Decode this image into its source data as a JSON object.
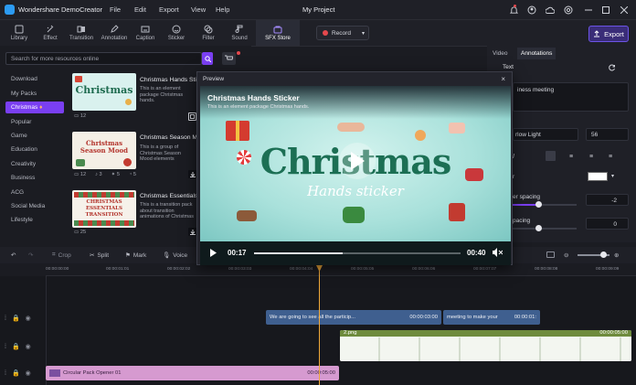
{
  "app": {
    "title": "Wondershare DemoCreator",
    "project": "My Project",
    "menu": [
      "File",
      "Edit",
      "Export",
      "View",
      "Help"
    ]
  },
  "toolbar": {
    "tools": [
      {
        "label": "Library",
        "icon": "library-icon"
      },
      {
        "label": "Effect",
        "icon": "effect-icon"
      },
      {
        "label": "Transition",
        "icon": "transition-icon"
      },
      {
        "label": "Annotation",
        "icon": "annotation-icon"
      },
      {
        "label": "Caption",
        "icon": "caption-icon"
      },
      {
        "label": "Sticker",
        "icon": "sticker-icon"
      },
      {
        "label": "Filter",
        "icon": "filter-icon"
      },
      {
        "label": "Sound",
        "icon": "sound-icon"
      },
      {
        "label": "SFX Store",
        "icon": "sfx-store-icon",
        "active": true
      }
    ],
    "record_label": "Record",
    "export_label": "Export"
  },
  "library": {
    "search_placeholder": "Search for more resources online",
    "categories": [
      {
        "label": "Download",
        "active": false
      },
      {
        "label": "My Packs",
        "active": false
      },
      {
        "label": "Christmas",
        "active": true
      },
      {
        "label": "Popular",
        "active": false
      },
      {
        "label": "Game",
        "active": false
      },
      {
        "label": "Education",
        "active": false
      },
      {
        "label": "Creativity",
        "active": false
      },
      {
        "label": "Business",
        "active": false
      },
      {
        "label": "ACG",
        "active": false
      },
      {
        "label": "Social Media",
        "active": false
      },
      {
        "label": "Lifestyle",
        "active": false
      }
    ],
    "cards": [
      {
        "title": "Christmas Hands Sticker",
        "desc": "This is an element package Christmas hands.",
        "stats": [
          "12"
        ],
        "thumb_text": "Christmas"
      },
      {
        "title": "Christmas Season Mood",
        "desc": "This is a group of Christmas Season Mood elements",
        "stats": [
          "12",
          "3",
          "5",
          "5"
        ],
        "thumb_text": "Christmas Season Mood"
      },
      {
        "title": "Christmas Essentials Tr...",
        "desc": "This is a transition pack about transition animations of Christmas",
        "stats": [
          "25"
        ],
        "thumb_text": "CHRISTMAS ESSENTIALS TRANSITION"
      }
    ]
  },
  "preview": {
    "header": "Preview",
    "title": "Christmas Hands Sticker",
    "subtitle": "This is an element package Christmas hands.",
    "headline": "Christmas",
    "subline": "Hands sticker",
    "current_time": "00:17",
    "total_time": "00:40",
    "progress": 0.43
  },
  "right_panel": {
    "tabs": [
      "Video",
      "Annotations"
    ],
    "section": "Text",
    "text_value": "iness meeting",
    "font": "rlow Light",
    "font_size": "56",
    "color_label": "r",
    "spacing_label": "er spacing",
    "spacing_value": "-2",
    "spacing2_label": "pacing",
    "spacing2_value": "0"
  },
  "timeline": {
    "tools": [
      "Crop",
      "Split",
      "Mark",
      "Voice"
    ],
    "ticks": [
      "00:00:00:00",
      "00:00:01:01",
      "00:00:02:02",
      "00:00:03:03",
      "00:00:04:04",
      "00:00:05:05",
      "00:00:06:06",
      "00:00:07:07",
      "00:00:08:08",
      "00:00:09:09"
    ],
    "clips": [
      {
        "label": "We are going to see all the particip...",
        "time": "00:00:03:00"
      },
      {
        "label": "meeting to make your",
        "time": "00:00:01:"
      },
      {
        "label": "2.png",
        "time": "00:00:05:00"
      },
      {
        "label": "Circular Pack Opener 01",
        "time": "00:00:05:00"
      }
    ]
  },
  "colors": {
    "accent": "#7a3ff2",
    "caption_clip": "#3f5f8f",
    "image_clip": "#6e8b3d",
    "pack_clip": "#d69ad0",
    "playhead": "#f1a93a"
  }
}
